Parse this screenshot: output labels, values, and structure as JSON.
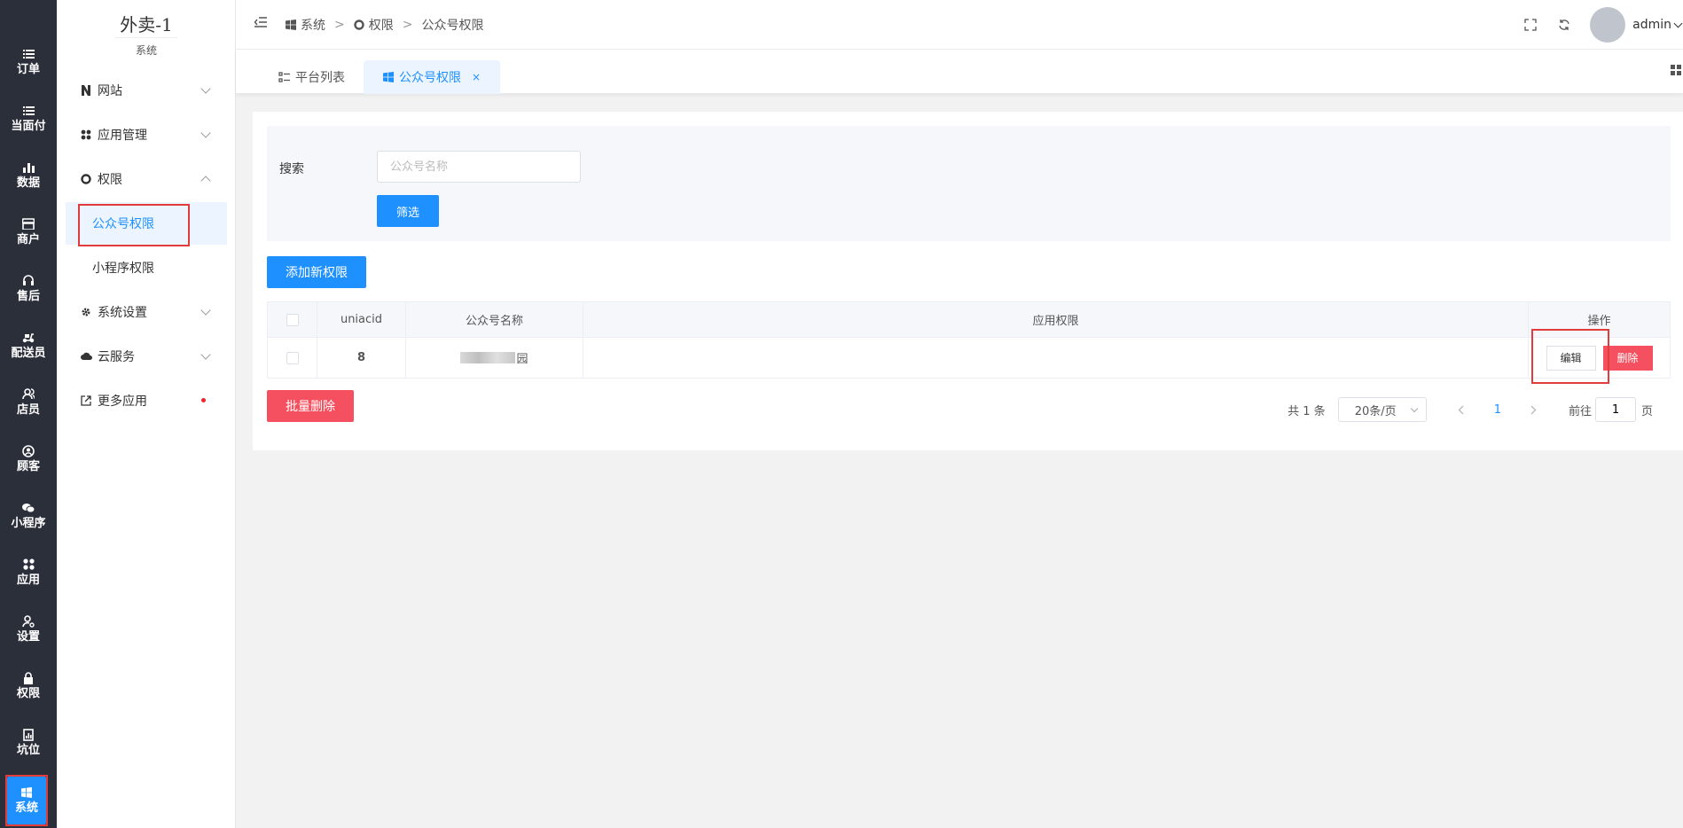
{
  "rail": [
    {
      "label": "订单",
      "icon": "list-icon"
    },
    {
      "label": "当面付",
      "icon": "list-icon"
    },
    {
      "label": "数据",
      "icon": "bar-chart-icon"
    },
    {
      "label": "商户",
      "icon": "store-icon"
    },
    {
      "label": "售后",
      "icon": "headset-icon"
    },
    {
      "label": "配送员",
      "icon": "scooter-icon"
    },
    {
      "label": "店员",
      "icon": "user-group-icon"
    },
    {
      "label": "顾客",
      "icon": "user-circle-icon"
    },
    {
      "label": "小程序",
      "icon": "wechat-icon"
    },
    {
      "label": "应用",
      "icon": "apps-icon"
    },
    {
      "label": "设置",
      "icon": "user-settings-icon"
    },
    {
      "label": "权限",
      "icon": "lock-icon"
    },
    {
      "label": "坑位",
      "icon": "report-icon"
    },
    {
      "label": "系统",
      "icon": "windows-icon"
    }
  ],
  "rail_active": "系统",
  "menu": {
    "brand": "外卖-1",
    "subtitle": "系统",
    "items": [
      {
        "label": "网站",
        "icon": "n-icon"
      },
      {
        "label": "应用管理",
        "icon": "apps-icon"
      },
      {
        "label": "权限",
        "icon": "circle-icon"
      },
      {
        "label": "公众号权限",
        "child": true,
        "active": true
      },
      {
        "label": "小程序权限",
        "child": true
      },
      {
        "label": "系统设置",
        "icon": "gear-icon"
      },
      {
        "label": "云服务",
        "icon": "cloud-icon"
      },
      {
        "label": "更多应用",
        "icon": "external-link-icon"
      }
    ]
  },
  "breadcrumb": [
    "系统",
    "权限",
    "公众号权限"
  ],
  "header": {
    "user": "admin"
  },
  "tabs": [
    {
      "label": "平台列表"
    },
    {
      "label": "公众号权限",
      "active": true,
      "close": "×"
    }
  ],
  "search": {
    "label": "搜索",
    "placeholder": "公众号名称",
    "value": "",
    "filter_label": "筛选"
  },
  "add_label": "添加新权限",
  "table": {
    "headers": [
      "uniacid",
      "公众号名称",
      "应用权限",
      "操作"
    ],
    "rows": [
      {
        "uniacid": "8",
        "name_visible": "园",
        "perms": ""
      }
    ],
    "edit_label": "编辑",
    "delete_label": "删除"
  },
  "batch_delete_label": "批量删除",
  "pager": {
    "total": "共 1 条",
    "page_size": "20条/页",
    "current": "1",
    "goto_label": "前往",
    "goto_value": "1",
    "page_suffix": "页"
  },
  "colors": {
    "primary": "#1e90ff",
    "danger": "#f5505f",
    "rail_bg": "#2b2f3a",
    "highlight_box": "#e23b3b"
  }
}
